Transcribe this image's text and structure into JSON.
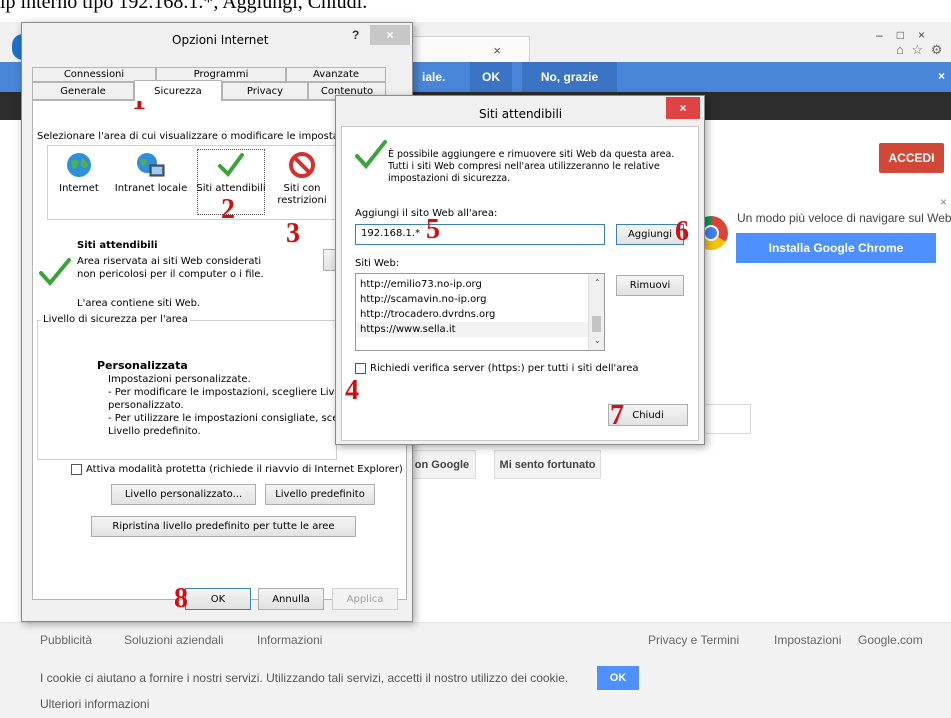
{
  "top_caption": "ip interno tipo 192.168.1.*, Aggiungi, Chiudi.",
  "browser": {
    "tab_close": "×",
    "notification": {
      "text": "iale.",
      "ok": "OK",
      "no": "No, grazie",
      "close": "×"
    },
    "accedi": "ACCEDI",
    "chrome_promo": "Un modo più veloce di navigare sul Web",
    "chrome_button": "Installa Google Chrome",
    "search_button": "on Google",
    "lucky_button": "Mi sento fortunato",
    "window_controls": {
      "min": "–",
      "max": "□",
      "close": "×"
    },
    "toolbar_icons": "⌂ ☆ ⚙",
    "footer": {
      "left": [
        "Pubblicità",
        "Soluzioni aziendali",
        "Informazioni"
      ],
      "right": [
        "Privacy e Termini",
        "Impostazioni",
        "Google.com"
      ],
      "cookie_text": "I cookie ci aiutano a fornire i nostri servizi. Utilizzando tali servizi, accetti il nostro utilizzo dei cookie.",
      "cookie_ok": "OK",
      "more_info": "Ulteriori informazioni"
    }
  },
  "internet_options": {
    "title": "Opzioni Internet",
    "help": "?",
    "close": "×",
    "tabs_row1": [
      "Connessioni",
      "Programmi",
      "Avanzate"
    ],
    "tabs_row2": [
      "Generale",
      "Sicurezza",
      "Privacy",
      "Contenuto"
    ],
    "zone_prompt": "Selezionare l'area di cui visualizzare o modificare le impostazioni",
    "zones": [
      {
        "label": "Internet",
        "icon": "globe-icon"
      },
      {
        "label": "Intranet locale",
        "icon": "intranet-icon"
      },
      {
        "label": "Siti attendibili",
        "icon": "checkmark-icon"
      },
      {
        "label": "Siti con restrizioni",
        "icon": "no-entry-icon"
      }
    ],
    "zone_title": "Siti attendibili",
    "zone_desc": "Area riservata ai siti Web considerati non pericolosi per il computer o i file.",
    "zone_contains": "L'area contiene siti Web.",
    "sites_button": "S",
    "security_level_label": "Livello di sicurezza per l'area",
    "custom_title": "Personalizzata",
    "custom_lines": [
      "Impostazioni personalizzate.",
      "- Per modificare le impostazioni, scegliere Livello",
      "personalizzato.",
      "- Per utilizzare le impostazioni consigliate, scegli",
      "Livello predefinito."
    ],
    "protected_mode": "Attiva modalità protetta (richiede il riavvio di Internet Explorer)",
    "custom_level_button": "Livello personalizzato...",
    "default_level_button": "Livello predefinito",
    "reset_all_button": "Ripristina livello predefinito per tutte le aree",
    "ok": "OK",
    "cancel": "Annulla",
    "apply": "Applica"
  },
  "trusted_sites": {
    "title": "Siti attendibili",
    "close": "×",
    "info": "È possibile aggiungere e rimuovere siti Web da questa area. Tutti i siti Web compresi nell'area utilizzeranno le relative impostazioni di sicurezza.",
    "add_label": "Aggiungi il sito Web all'area:",
    "add_value": "192.168.1.*",
    "add_button": "Aggiungi",
    "sites_label": "Siti Web:",
    "sites": [
      "http://emilio73.no-ip.org",
      "http://scamavin.no-ip.org",
      "http://trocadero.dvrdns.org",
      "https://www.sella.it"
    ],
    "remove_button": "Rimuovi",
    "require_https": "Richiedi verifica server (https:) per tutti i siti dell'area",
    "close_button": "Chiudi"
  },
  "annotations": [
    "1",
    "2",
    "3",
    "4",
    "5",
    "6",
    "7",
    "8"
  ],
  "colors": {
    "accent_blue": "#4a86d8",
    "accedi_red": "#d14836",
    "annotation_red": "#d01010",
    "chrome_blue": "#4d90fe"
  }
}
